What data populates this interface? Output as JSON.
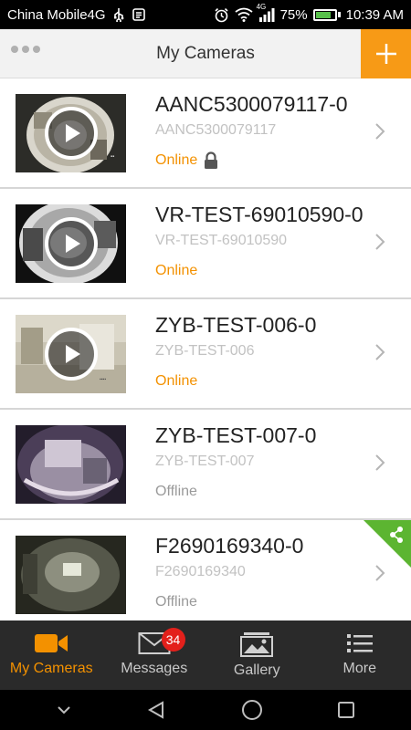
{
  "status_bar": {
    "carrier": "China Mobile4G",
    "network_type": "4G",
    "battery_percent": "75%",
    "battery_level": 0.75,
    "time": "10:39 AM",
    "icons": [
      "usb-icon",
      "notification-icon",
      "alarm-icon",
      "wifi-icon",
      "signal-icon",
      "battery-icon"
    ]
  },
  "header": {
    "title": "My Cameras",
    "menu_icon": "more-dots-icon",
    "add_icon": "plus-icon",
    "accent_color": "#f79a16"
  },
  "cameras": [
    {
      "name": "AANC5300079117-0",
      "id": "AANC5300079117",
      "status": "Online",
      "online": true,
      "locked": true,
      "shared": false,
      "has_play": true
    },
    {
      "name": "VR-TEST-69010590-0",
      "id": "VR-TEST-69010590",
      "status": "Online",
      "online": true,
      "locked": false,
      "shared": false,
      "has_play": true
    },
    {
      "name": "ZYB-TEST-006-0",
      "id": "ZYB-TEST-006",
      "status": "Online",
      "online": true,
      "locked": false,
      "shared": false,
      "has_play": true
    },
    {
      "name": "ZYB-TEST-007-0",
      "id": "ZYB-TEST-007",
      "status": "Offline",
      "online": false,
      "locked": false,
      "shared": false,
      "has_play": false
    },
    {
      "name": "F2690169340-0",
      "id": "F2690169340",
      "status": "Offline",
      "online": false,
      "locked": false,
      "shared": true,
      "has_play": false
    }
  ],
  "status_colors": {
    "online": "#f39100",
    "offline": "#9a9a9a",
    "shared": "#5cb531"
  },
  "tabs": [
    {
      "label": "My Cameras",
      "icon": "video-camera-icon",
      "active": true
    },
    {
      "label": "Messages",
      "icon": "envelope-icon",
      "active": false,
      "badge": "34"
    },
    {
      "label": "Gallery",
      "icon": "gallery-icon",
      "active": false
    },
    {
      "label": "More",
      "icon": "list-icon",
      "active": false
    }
  ],
  "nav_bar": {
    "icons": [
      "chevron-down-icon",
      "back-icon",
      "home-icon",
      "recents-icon"
    ]
  }
}
